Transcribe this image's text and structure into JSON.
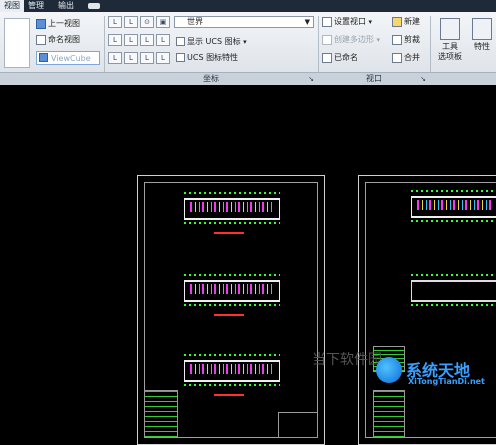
{
  "menubar": {
    "tabs": [
      "视图",
      "管理",
      "输出"
    ]
  },
  "ribbon": {
    "view_panel": {
      "buttons": [
        "上一视图",
        "命名视图",
        "ViewCube"
      ]
    },
    "ucs_panel": {
      "combo_value": "世界",
      "show_ucs_icon": "显示 UCS 图标",
      "ucs_icon_props": "UCS 图标特性",
      "title": "坐标"
    },
    "viewport_panel": {
      "setup_viewport": "设置视口",
      "create_polygon": "创建多边形",
      "named": "已命名",
      "new": "新建",
      "clip": "剪裁",
      "merge": "合并",
      "title": "视口"
    },
    "tools_panel": {
      "tools": "工具",
      "palette": "选项板",
      "properties": "特性"
    }
  },
  "watermark": {
    "brand": "系统天地",
    "url": "XiTongTianDi.net",
    "ghost_text": "当下软件园"
  },
  "colors": {
    "ribbon_bg": "#e6eaef",
    "canvas_bg": "#000000",
    "accent": "#3aa0ff"
  }
}
